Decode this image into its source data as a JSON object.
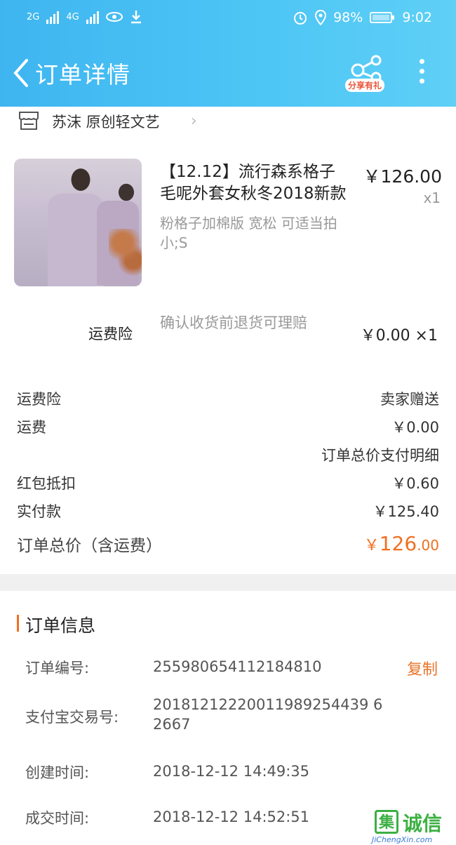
{
  "status_bar": {
    "net1": "2G",
    "net2": "4G",
    "battery": "98%",
    "time": "9:02"
  },
  "header": {
    "title": "订单详情",
    "share_label": "分享有礼"
  },
  "shop": {
    "name": "苏沫 原创轻文艺"
  },
  "product": {
    "title_line1": "【12.12】流行森系格子",
    "title_line2": "毛呢外套女秋冬2018新款",
    "price": "￥126.00",
    "qty": "x1",
    "sku": "粉格子加棉版 宽松 可适当拍小;S"
  },
  "insurance": {
    "label": "运费险",
    "desc": "确认收货前退货可理赔",
    "price": "￥0.00 ×1"
  },
  "summary": {
    "rows": [
      {
        "k": "运费险",
        "v": "卖家赠送"
      },
      {
        "k": "运费",
        "v": "￥0.00"
      },
      {
        "k": "",
        "v": "订单总价支付明细"
      },
      {
        "k": "红包抵扣",
        "v": "￥0.60"
      },
      {
        "k": "实付款",
        "v": "￥125.40"
      }
    ],
    "total_label": "订单总价（含运费）",
    "total_currency": "￥",
    "total_int": "126",
    "total_dec": ".00"
  },
  "order_info": {
    "heading": "订单信息",
    "order_no_label": "订单编号:",
    "order_no": "2559806541121848​10",
    "copy_label": "复制",
    "alipay_label": "支付宝交易号:",
    "alipay_no": "20181212220011989254439 62667",
    "created_label": "创建时间:",
    "created": "2018-12-12 14:49:35",
    "deal_label": "成交时间:",
    "deal": "2018-12-12 14:52:51"
  },
  "watermark": {
    "box": "集",
    "text": "诚信",
    "sub": "JiChengXin.com"
  },
  "colors": {
    "header": "#4ec6f5",
    "accent": "#f07020"
  }
}
